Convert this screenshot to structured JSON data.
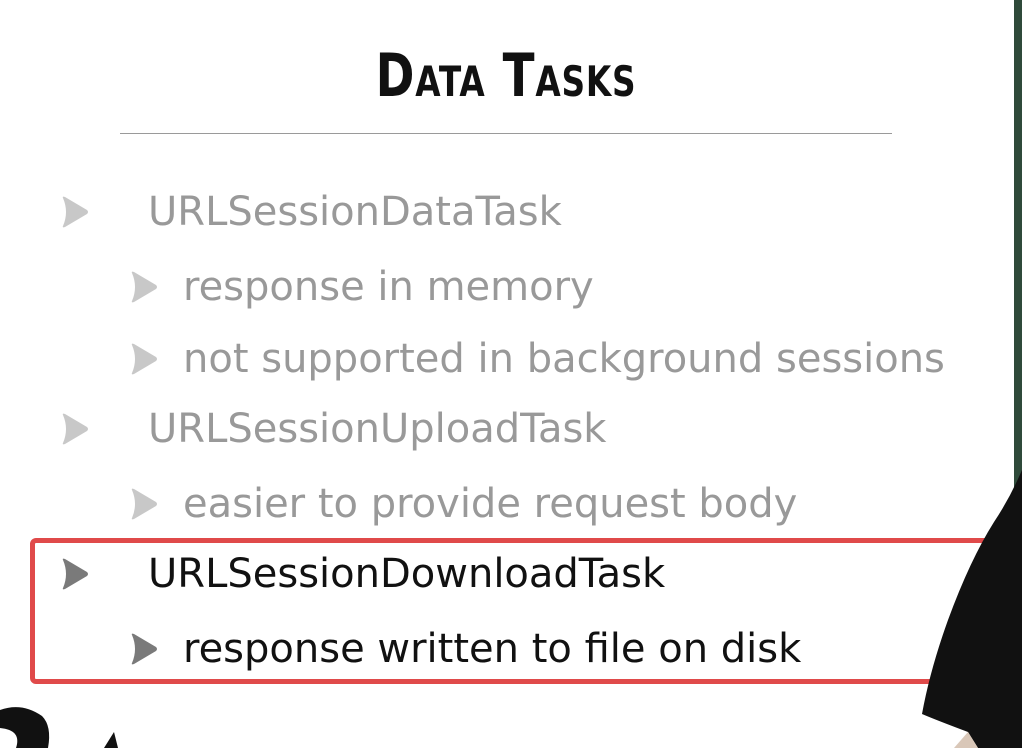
{
  "slide": {
    "title": "Data Tasks",
    "items": [
      {
        "level": 1,
        "text": "URLSessionDataTask",
        "highlighted": false
      },
      {
        "level": 2,
        "text": "response in memory",
        "highlighted": false
      },
      {
        "level": 2,
        "text": "not supported in background sessions",
        "highlighted": false
      },
      {
        "level": 1,
        "text": "URLSessionUploadTask",
        "highlighted": false
      },
      {
        "level": 2,
        "text": "easier to provide request body",
        "highlighted": false
      },
      {
        "level": 1,
        "text": "URLSessionDownloadTask",
        "highlighted": true
      },
      {
        "level": 2,
        "text": "response written to file on disk",
        "highlighted": true
      }
    ]
  },
  "icons": {
    "bullet": "triangle-bullet-icon"
  },
  "colors": {
    "text_dim": "#999999",
    "text_active": "#111111",
    "highlight_border": "#e04a4a",
    "bullet_dim": "#c8c8c8",
    "bullet_active": "#7a7a7a"
  }
}
